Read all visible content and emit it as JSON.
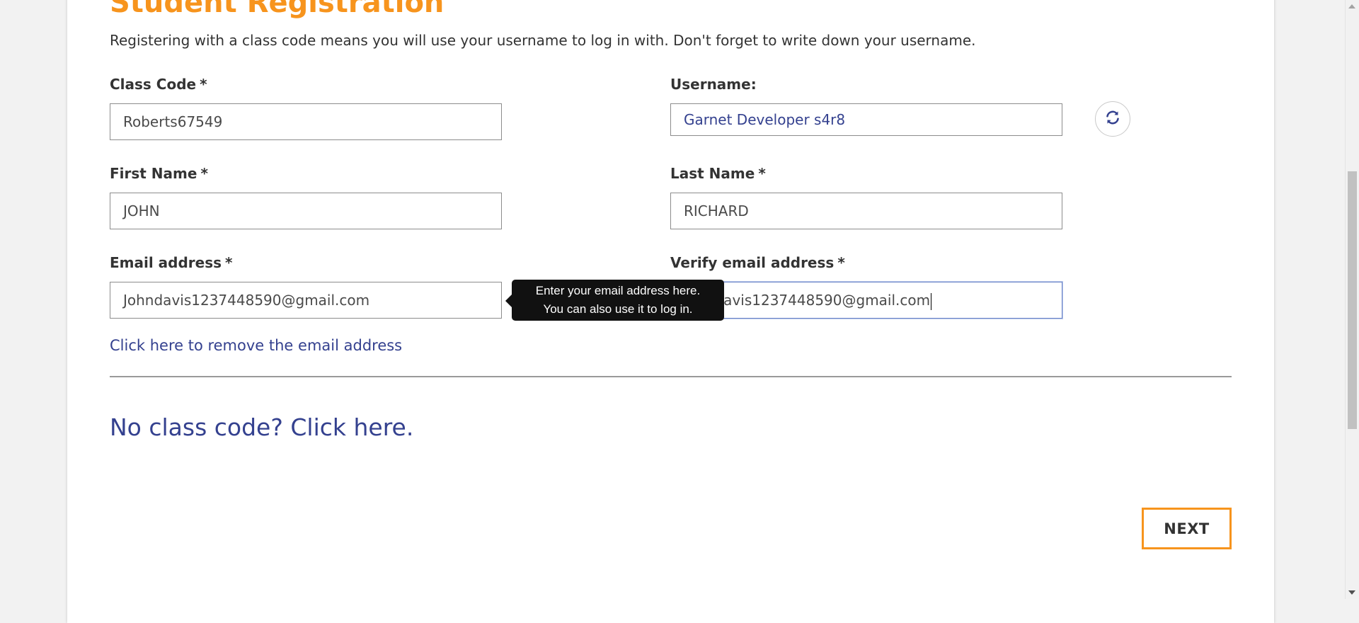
{
  "form": {
    "title": "Student Registration",
    "intro": "Registering with a class code means you will use your username to log in with. Don't forget to write down your username.",
    "required_marker": "*",
    "class_code": {
      "label": "Class Code",
      "value": "Roberts67549"
    },
    "username": {
      "label": "Username:",
      "value": "Garnet Developer s4r8",
      "refresh_icon": "refresh-icon"
    },
    "first_name": {
      "label": "First Name",
      "value": "JOHN"
    },
    "last_name": {
      "label": "Last Name",
      "value": "RICHARD"
    },
    "email": {
      "label": "Email address",
      "value": "Johndavis1237448590@gmail.com"
    },
    "verify_email": {
      "label": "Verify email address",
      "value": "Johndavis1237448590@gmail.com"
    },
    "tooltip": {
      "line1": "Enter your email address here.",
      "line2": "You can also use it to log in."
    },
    "remove_email_link": "Click here to remove the email address",
    "no_class_code_link": "No class code? Click here.",
    "next_button": "NEXT"
  },
  "colors": {
    "accent": "#f7941d",
    "link": "#34418f",
    "text": "#333333",
    "tooltip_bg": "#111111"
  }
}
